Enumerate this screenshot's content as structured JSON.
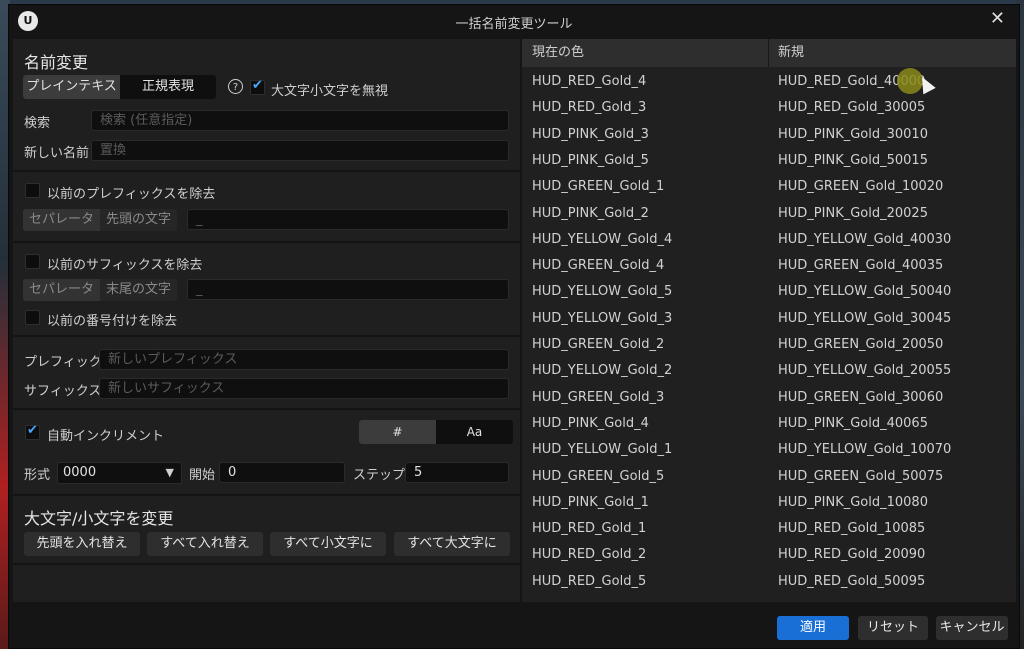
{
  "window": {
    "title": "一括名前変更ツール",
    "logo_text": "U"
  },
  "rename": {
    "heading": "名前変更",
    "mode_plain": "プレインテキスト",
    "mode_regex": "正規表現",
    "help": "?",
    "ignore_case_label": "大文字小文字を無視",
    "ignore_case_checked": true,
    "search_label": "検索",
    "search_placeholder": "検索 (任意指定)",
    "newname_label": "新しい名前",
    "newname_placeholder": "置換"
  },
  "prefix_remove": {
    "label": "以前のプレフィックスを除去",
    "separator_tag": "セパレータ",
    "position_tag": "先頭の文字",
    "value": "_"
  },
  "suffix_remove": {
    "label": "以前のサフィックスを除去",
    "separator_tag": "セパレータ",
    "position_tag": "末尾の文字",
    "value": "_",
    "numbering_label": "以前の番号付けを除去"
  },
  "affix": {
    "prefix_label": "プレフィック.",
    "prefix_placeholder": "新しいプレフィックス",
    "suffix_label": "サフィックス",
    "suffix_placeholder": "新しいサフィックス"
  },
  "increment": {
    "label": "自動インクリメント",
    "checked": true,
    "mode_hash": "#",
    "mode_alpha": "Aa",
    "format_label": "形式",
    "format_value": "0000",
    "start_label": "開始",
    "start_value": "0",
    "step_label": "ステップ",
    "step_value": "5"
  },
  "case": {
    "heading": "大文字/小文字を変更",
    "btn_first": "先頭を入れ替え",
    "btn_swap": "すべて入れ替え",
    "btn_lower": "すべて小文字に",
    "btn_upper": "すべて大文字に"
  },
  "table": {
    "col_current": "現在の色",
    "col_new": "新規",
    "rows": [
      {
        "current": "HUD_RED_Gold_4",
        "new": "HUD_RED_Gold_40000"
      },
      {
        "current": "HUD_RED_Gold_3",
        "new": "HUD_RED_Gold_30005"
      },
      {
        "current": "HUD_PINK_Gold_3",
        "new": "HUD_PINK_Gold_30010"
      },
      {
        "current": "HUD_PINK_Gold_5",
        "new": "HUD_PINK_Gold_50015"
      },
      {
        "current": "HUD_GREEN_Gold_1",
        "new": "HUD_GREEN_Gold_10020"
      },
      {
        "current": "HUD_PINK_Gold_2",
        "new": "HUD_PINK_Gold_20025"
      },
      {
        "current": "HUD_YELLOW_Gold_4",
        "new": "HUD_YELLOW_Gold_40030"
      },
      {
        "current": "HUD_GREEN_Gold_4",
        "new": "HUD_GREEN_Gold_40035"
      },
      {
        "current": "HUD_YELLOW_Gold_5",
        "new": "HUD_YELLOW_Gold_50040"
      },
      {
        "current": "HUD_YELLOW_Gold_3",
        "new": "HUD_YELLOW_Gold_30045"
      },
      {
        "current": "HUD_GREEN_Gold_2",
        "new": "HUD_GREEN_Gold_20050"
      },
      {
        "current": "HUD_YELLOW_Gold_2",
        "new": "HUD_YELLOW_Gold_20055"
      },
      {
        "current": "HUD_GREEN_Gold_3",
        "new": "HUD_GREEN_Gold_30060"
      },
      {
        "current": "HUD_PINK_Gold_4",
        "new": "HUD_PINK_Gold_40065"
      },
      {
        "current": "HUD_YELLOW_Gold_1",
        "new": "HUD_YELLOW_Gold_10070"
      },
      {
        "current": "HUD_GREEN_Gold_5",
        "new": "HUD_GREEN_Gold_50075"
      },
      {
        "current": "HUD_PINK_Gold_1",
        "new": "HUD_PINK_Gold_10080"
      },
      {
        "current": "HUD_RED_Gold_1",
        "new": "HUD_RED_Gold_10085"
      },
      {
        "current": "HUD_RED_Gold_2",
        "new": "HUD_RED_Gold_20090"
      },
      {
        "current": "HUD_RED_Gold_5",
        "new": "HUD_RED_Gold_50095"
      }
    ]
  },
  "footer": {
    "apply": "適用",
    "reset": "リセット",
    "cancel": "キャンセル"
  },
  "colors": {
    "accent": "#1a6fd6",
    "check": "#4aa8ff"
  }
}
